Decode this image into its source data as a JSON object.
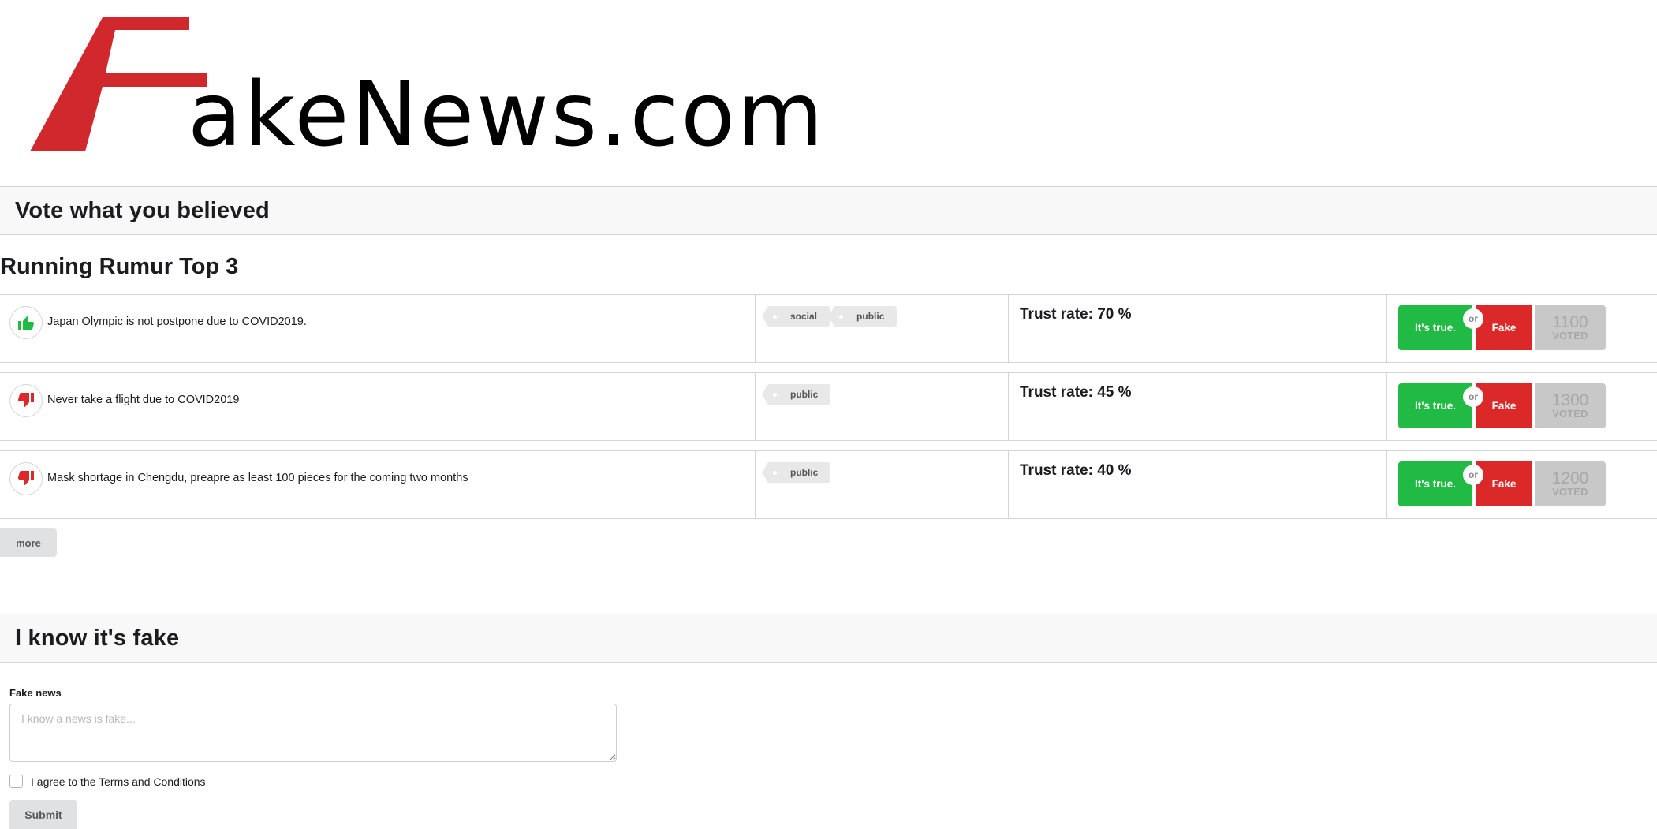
{
  "logo": {
    "text": "akeNews.com",
    "letter": "F",
    "brand_color": "#d0282c"
  },
  "sections": {
    "vote_header": "Vote what you believed",
    "top_title": "Running Rumur Top 3",
    "report_header": "I know it's fake"
  },
  "rumors": [
    {
      "headline": "Japan Olympic is not postpone due to COVID2019.",
      "icon": "thumbs-up-icon",
      "tags": [
        "social",
        "public"
      ],
      "trust": "Trust rate: 70 %",
      "true_label": "It's true.",
      "or_label": "or",
      "fake_label": "Fake",
      "count": "1100",
      "count_label": "VOTED"
    },
    {
      "headline": "Never take a flight due to COVID2019",
      "icon": "thumbs-down-icon",
      "tags": [
        "public"
      ],
      "trust": "Trust rate: 45 %",
      "true_label": "It's true.",
      "or_label": "or",
      "fake_label": "Fake",
      "count": "1300",
      "count_label": "VOTED"
    },
    {
      "headline": "Mask shortage in Chengdu, preapre as least 100 pieces for the coming two months",
      "icon": "thumbs-down-icon",
      "tags": [
        "public"
      ],
      "trust": "Trust rate: 40 %",
      "true_label": "It's true.",
      "or_label": "or",
      "fake_label": "Fake",
      "count": "1200",
      "count_label": "VOTED"
    }
  ],
  "more_label": "more",
  "form": {
    "label": "Fake news",
    "placeholder": "I know a news is fake...",
    "agree_label": "I agree to the Terms and Conditions",
    "submit_label": "Submit"
  },
  "colors": {
    "true_green": "#21ba45",
    "fake_red": "#db2828",
    "thumb_up_color": "#21ba45",
    "thumb_down_color": "#db2828"
  }
}
